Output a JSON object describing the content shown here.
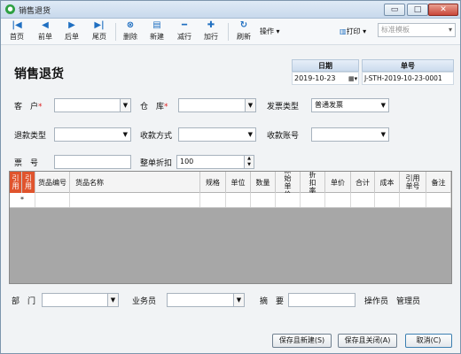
{
  "window": {
    "title": "销售退货",
    "minimize": "▭",
    "maximize": "□",
    "close": "✕"
  },
  "toolbar": {
    "first": "首页",
    "prev": "前单",
    "next": "后单",
    "last": "尾页",
    "delete": "删除",
    "new": "新建",
    "delete_row": "减行",
    "add_row": "加行",
    "refresh": "刷新",
    "operate": "操作",
    "print": "打印",
    "template_placeholder": "标准模板"
  },
  "page": {
    "title": "销售退货"
  },
  "header": {
    "date_label": "日期",
    "date_value": "2019-10-23",
    "number_label": "单号",
    "number_value": "J-STH-2019-10-23-0001"
  },
  "form": {
    "customer_label": "客　户",
    "customer_value": "",
    "warehouse_label": "仓　库",
    "warehouse_value": "",
    "invoice_type_label": "发票类型",
    "invoice_type_value": "普通发票",
    "refund_type_label": "退款类型",
    "refund_type_value": "",
    "payment_method_label": "收款方式",
    "payment_method_value": "",
    "account_label": "收款账号",
    "account_value": "",
    "ticket_label": "票　号",
    "ticket_value": "",
    "discount_label": "整单折扣",
    "discount_value": "100"
  },
  "grid": {
    "columns": [
      "引用",
      "引用",
      "货品编号",
      "货品名称",
      "规格",
      "单位",
      "数量",
      "原始单价",
      "折扣率",
      "单价",
      "合计",
      "成本",
      "引用单号",
      "备注"
    ],
    "row_marker": "*"
  },
  "footer": {
    "dept_label": "部　门",
    "dept_value": "",
    "salesman_label": "业务员",
    "salesman_value": "",
    "summary_label": "摘　要",
    "summary_value": "",
    "operator_label": "操作员",
    "operator_value": "管理员"
  },
  "buttons": {
    "save_new": "保存且新建(S)",
    "save_close": "保存且关闭(A)",
    "cancel": "取消(C)"
  },
  "colors": {
    "accent": "#1f6fc1",
    "ref_column": "#e0542d",
    "grid_empty": "#a7a7a7"
  }
}
